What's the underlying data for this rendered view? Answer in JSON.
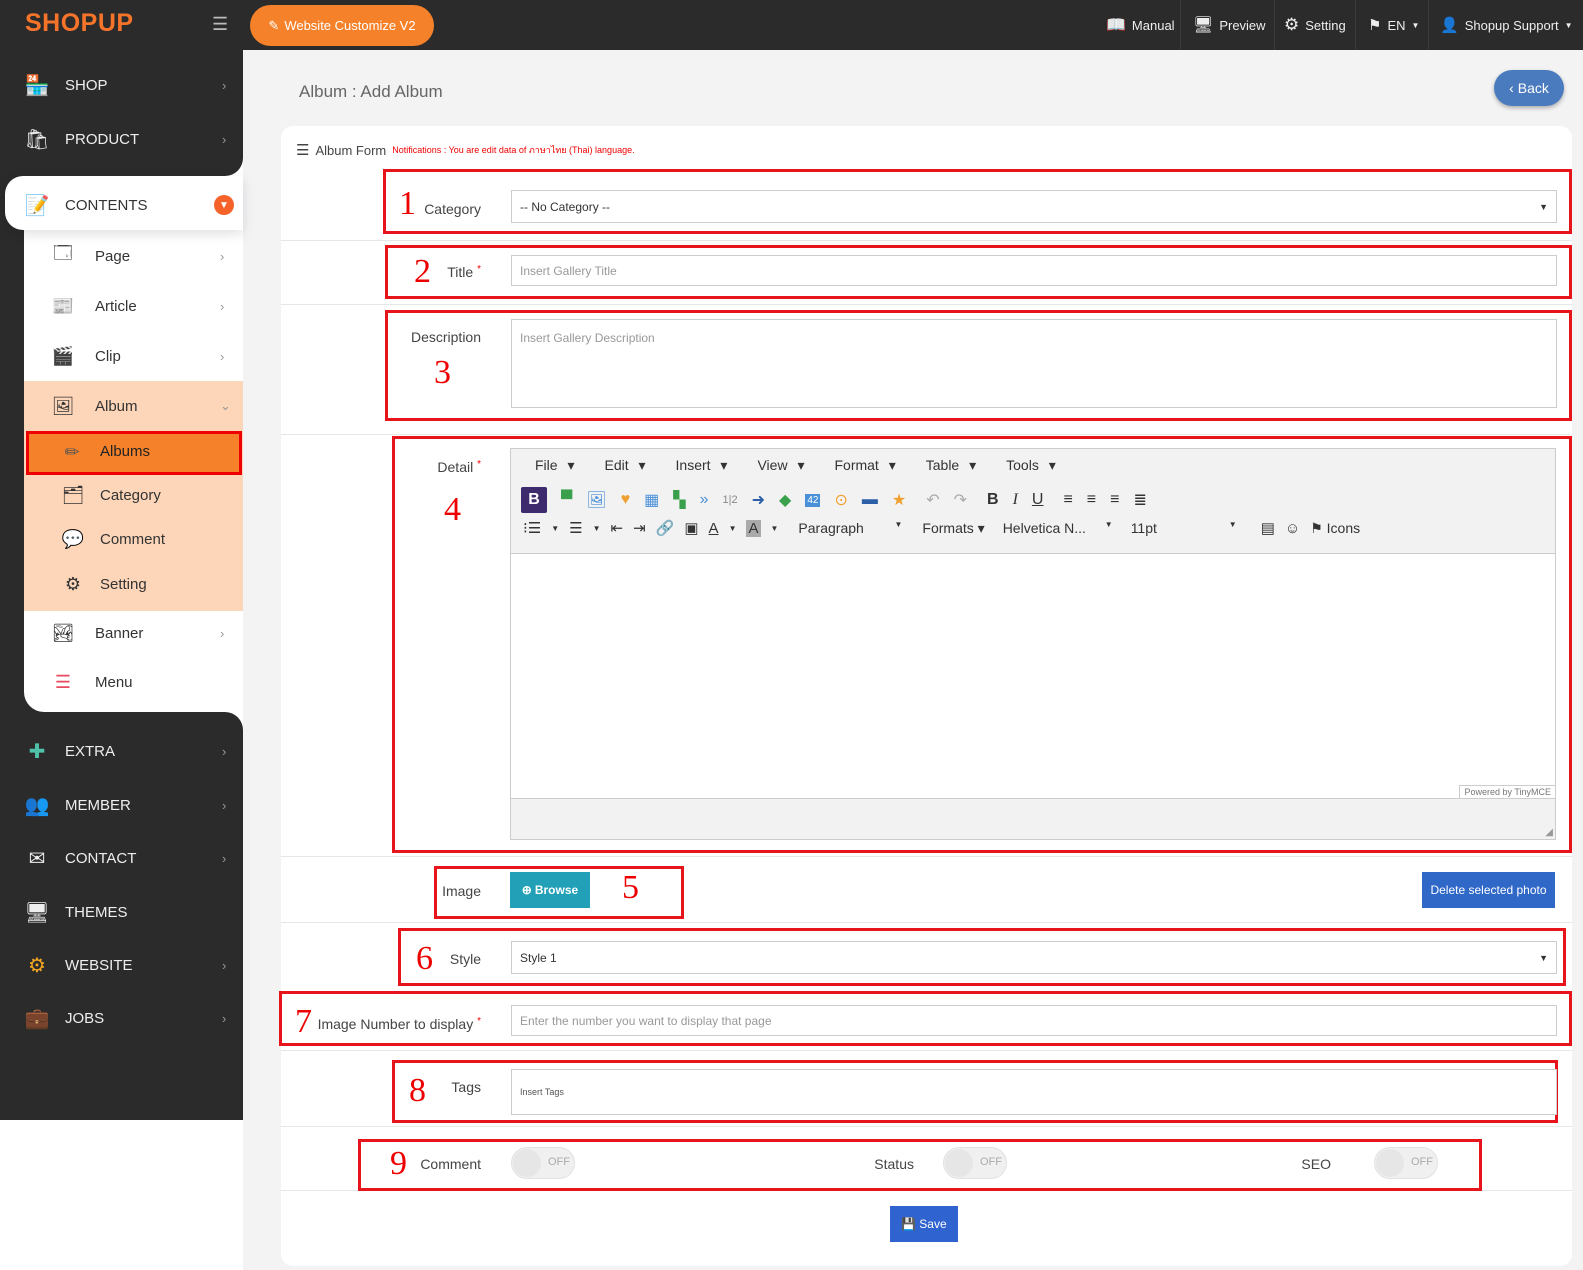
{
  "brand": {
    "logo_text": "SHOPUP"
  },
  "topbar": {
    "customize_label": "Website Customize V2",
    "manual_label": "Manual",
    "preview_label": "Preview",
    "setting_label": "Setting",
    "language_label": "EN",
    "support_label": "Shopup Support"
  },
  "sidebar": {
    "shop": "SHOP",
    "product": "PRODUCT",
    "contents": "CONTENTS",
    "contents_sub": {
      "page": "Page",
      "article": "Article",
      "clip": "Clip",
      "album": "Album",
      "album_sub": {
        "albums": "Albums",
        "category": "Category",
        "comment": "Comment",
        "setting": "Setting"
      },
      "banner": "Banner",
      "menu": "Menu"
    },
    "extra": "EXTRA",
    "member": "MEMBER",
    "contact": "CONTACT",
    "themes": "THEMES",
    "website": "WEBSITE",
    "jobs": "JOBS"
  },
  "page": {
    "title": "Album : Add Album",
    "back_label": "Back"
  },
  "form": {
    "title": "Album Form",
    "notice": "Notifications : You are edit data of ภาษาไทย (Thai) language.",
    "category": {
      "label": "Category",
      "value": "-- No Category --"
    },
    "title_field": {
      "label": "Title",
      "required": "*",
      "placeholder": "Insert Gallery Title"
    },
    "description": {
      "label": "Description",
      "placeholder": "Insert Gallery Description"
    },
    "detail": {
      "label": "Detail",
      "required": "*"
    },
    "image": {
      "label": "Image",
      "browse_label": "Browse",
      "delete_label": "Delete selected photo"
    },
    "style": {
      "label": "Style",
      "value": "Style 1"
    },
    "image_number": {
      "label": "Image Number to display",
      "required": "*",
      "placeholder": "Enter the number you want to display that page"
    },
    "tags": {
      "label": "Tags",
      "placeholder": "Insert Tags"
    },
    "comment": {
      "label": "Comment",
      "state": "OFF"
    },
    "status": {
      "label": "Status",
      "state": "OFF"
    },
    "seo": {
      "label": "SEO",
      "state": "OFF"
    },
    "save_label": "Save"
  },
  "editor": {
    "menus": [
      "File",
      "Edit",
      "Insert",
      "View",
      "Format",
      "Table",
      "Tools"
    ],
    "paragraph_label": "Paragraph",
    "formats_label": "Formats",
    "font_label": "Helvetica N...",
    "size_label": "11pt",
    "icons_label": "Icons",
    "powered": "Powered by TinyMCE"
  },
  "annotations": [
    "1",
    "2",
    "3",
    "4",
    "5",
    "6",
    "7",
    "8",
    "9"
  ],
  "colors": {
    "accent_orange": "#f5822a",
    "topbar_bg": "#2b2b2b",
    "highlight_red": "#e8141c",
    "save_blue": "#2f63d0"
  }
}
